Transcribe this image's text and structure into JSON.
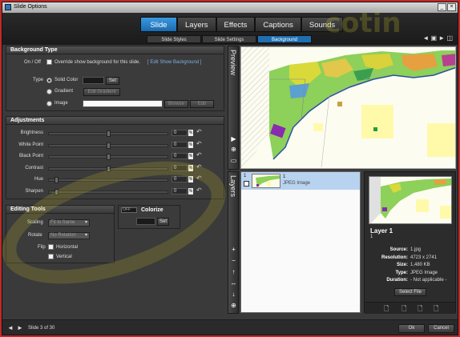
{
  "window": {
    "title": "Slide Options"
  },
  "tabs": [
    "Slide",
    "Layers",
    "Effects",
    "Captions",
    "Sounds"
  ],
  "subtabs": [
    "Slide Styles",
    "Slide Settings",
    "Background"
  ],
  "bg_type": {
    "header": "Background Type",
    "onoff_label": "On / Off",
    "override_text": "Override show background for this slide.",
    "edit_link": "[ Edit Show Background ]",
    "type_label": "Type",
    "solid_color": "Solid Color",
    "set": "Set",
    "gradient": "Gradient",
    "edit_gradient": "Edit Gradient",
    "image": "Image",
    "browse": "Browse",
    "edit": "Edit"
  },
  "adjustments": {
    "header": "Adjustments",
    "rows": [
      {
        "label": "Brightness",
        "value": "0",
        "level": 0.5
      },
      {
        "label": "White Point",
        "value": "0",
        "level": 0.5
      },
      {
        "label": "Black Point",
        "value": "0",
        "level": 0.5
      },
      {
        "label": "Contrast",
        "value": "0",
        "level": 0.5
      },
      {
        "label": "Hue",
        "value": "0",
        "level": 0.05
      },
      {
        "label": "Sharpen",
        "value": "0",
        "level": 0.05
      }
    ],
    "pct": "%"
  },
  "editing": {
    "header": "Editing Tools",
    "scaling_label": "Scaling",
    "scaling_value": "Fit to frame",
    "rotate_label": "Rotate",
    "rotate_value": "No Rotation",
    "flip_label": "Flip",
    "horizontal": "Horizontal",
    "vertical": "Vertical"
  },
  "colorize": {
    "toggle": "OFF",
    "header": "Colorize",
    "set": "Set"
  },
  "preview_label": "Preview",
  "layers_label": "Layers",
  "layer_row": {
    "number": "1",
    "checkbox_num": "1",
    "name": "1",
    "type": "JPEG Image"
  },
  "info": {
    "title": "Layer 1",
    "number": "1",
    "fields": [
      {
        "k": "Source:",
        "v": "1.jpg"
      },
      {
        "k": "Resolution:",
        "v": "4723 x 2741"
      },
      {
        "k": "Size:",
        "v": "1,480 KB"
      },
      {
        "k": "Type:",
        "v": "JPEG Image"
      },
      {
        "k": "Duration:",
        "v": "- Not applicable -"
      }
    ],
    "select_file": "Select File"
  },
  "footer": {
    "slide": "Slide 3 of 30",
    "ok": "Ok",
    "cancel": "Cancel"
  },
  "watermark": "cotin",
  "colors": {
    "accent": "#1f6fb0",
    "accent_tab": "#2a86d0",
    "window_bg": "#3a3a3a"
  }
}
